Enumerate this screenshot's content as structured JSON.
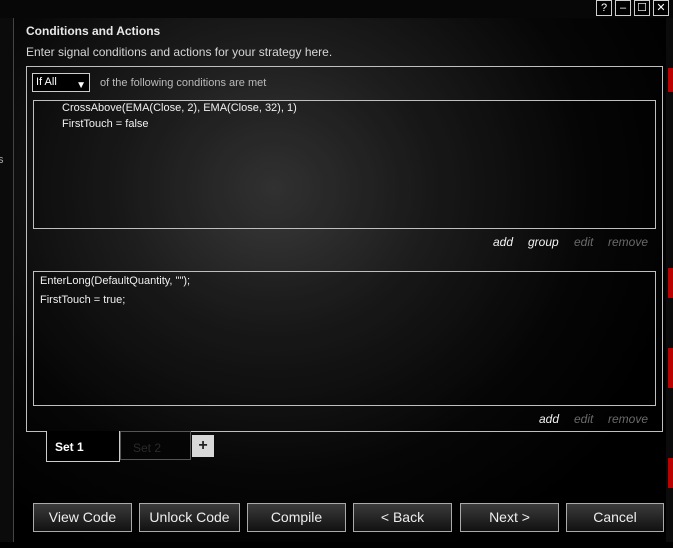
{
  "window": {
    "help_btn": "?",
    "min_btn": "–",
    "max_btn": "☐",
    "close_btn": "✕"
  },
  "left_strip": {
    "text": "s"
  },
  "header": {
    "title": "Conditions and Actions",
    "subtitle": "Enter signal conditions and actions for your strategy here."
  },
  "conditions": {
    "selector_value": "If All",
    "selector_label": "of the following conditions are met",
    "lines": [
      "CrossAbove(EMA(Close, 2), EMA(Close, 32), 1)",
      "FirstTouch = false"
    ],
    "links": {
      "add": "add",
      "group": "group",
      "edit": "edit",
      "remove": "remove"
    }
  },
  "actions": {
    "lines": [
      "EnterLong(DefaultQuantity, \"\");",
      "FirstTouch = true;"
    ],
    "links": {
      "add": "add",
      "edit": "edit",
      "remove": "remove"
    }
  },
  "sets": {
    "tabs": [
      "Set 1",
      "Set 2"
    ],
    "add_label": "+"
  },
  "buttons": {
    "view_code": "View Code",
    "unlock_code": "Unlock Code",
    "compile": "Compile",
    "back": "< Back",
    "next": "Next >",
    "cancel": "Cancel"
  },
  "colors": {
    "background": "#000000",
    "border": "#bfbfbf",
    "disabled_link": "#6a6a6a"
  }
}
